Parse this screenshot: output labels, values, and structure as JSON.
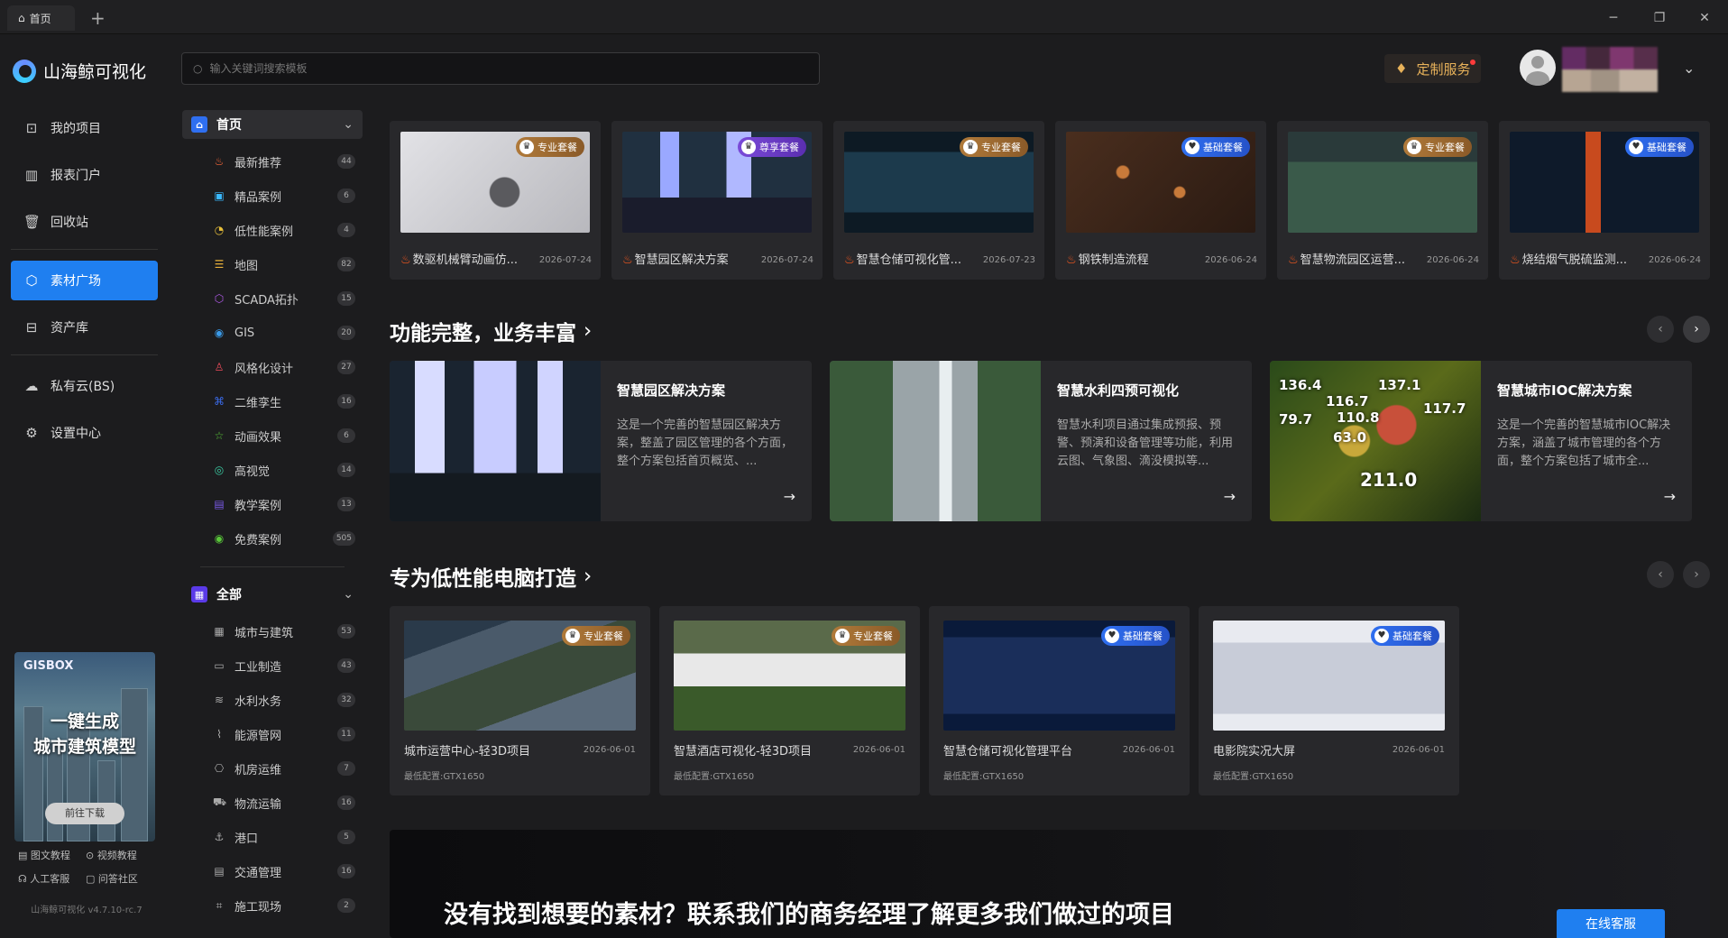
{
  "tabbar": {
    "tab_label": "首页",
    "add_tab": "+",
    "minimize": "─",
    "restore": "❐",
    "close": "✕"
  },
  "brand": {
    "name": "山海鲸可视化"
  },
  "search": {
    "placeholder": "输入关键词搜索模板"
  },
  "header": {
    "custom_service": "定制服务"
  },
  "nav": {
    "items": [
      {
        "label": "我的项目",
        "icon": "project-icon"
      },
      {
        "label": "报表门户",
        "icon": "report-icon"
      },
      {
        "label": "回收站",
        "icon": "trash-icon"
      },
      {
        "label": "素材广场",
        "icon": "cube-icon",
        "active": true
      },
      {
        "label": "资产库",
        "icon": "asset-icon"
      },
      {
        "label": "私有云(BS)",
        "icon": "cloud-icon"
      },
      {
        "label": "设置中心",
        "icon": "gear-icon"
      }
    ]
  },
  "promo": {
    "brand": "GISBOX",
    "line1": "一键生成",
    "line2": "城市建筑模型",
    "button": "前往下载"
  },
  "help": {
    "links": [
      "图文教程",
      "视频教程",
      "人工客服",
      "问答社区"
    ]
  },
  "version": "山海鲸可视化 v4.7.10-rc.7",
  "categories": {
    "home_label": "首页",
    "home_items": [
      {
        "label": "最新推荐",
        "count": "44",
        "color": "#ff6a3a",
        "glyph": "♨"
      },
      {
        "label": "精品案例",
        "count": "6",
        "color": "#3ab8ff",
        "glyph": "▣"
      },
      {
        "label": "低性能案例",
        "count": "4",
        "color": "#e8c03a",
        "glyph": "◔"
      },
      {
        "label": "地图",
        "count": "82",
        "color": "#e8b03a",
        "glyph": "☰"
      },
      {
        "label": "SCADA拓扑",
        "count": "15",
        "color": "#b05ae8",
        "glyph": "⬡"
      },
      {
        "label": "GIS",
        "count": "20",
        "color": "#3a9ae8",
        "glyph": "◉"
      },
      {
        "label": "风格化设计",
        "count": "27",
        "color": "#e84a5a",
        "glyph": "♙"
      },
      {
        "label": "二维孪生",
        "count": "16",
        "color": "#3a6ae8",
        "glyph": "⌘"
      },
      {
        "label": "动画效果",
        "count": "6",
        "color": "#5ac83a",
        "glyph": "☆"
      },
      {
        "label": "高视觉",
        "count": "14",
        "color": "#3ac8a0",
        "glyph": "◎"
      },
      {
        "label": "教学案例",
        "count": "13",
        "color": "#7a5ae8",
        "glyph": "▤"
      },
      {
        "label": "免费案例",
        "count": "505",
        "color": "#5ac83a",
        "glyph": "◉"
      }
    ],
    "all_label": "全部",
    "all_items": [
      {
        "label": "城市与建筑",
        "count": "53",
        "glyph": "▦"
      },
      {
        "label": "工业制造",
        "count": "43",
        "glyph": "▭"
      },
      {
        "label": "水利水务",
        "count": "32",
        "glyph": "≋"
      },
      {
        "label": "能源管网",
        "count": "11",
        "glyph": "⌇"
      },
      {
        "label": "机房运维",
        "count": "7",
        "glyph": "⎔"
      },
      {
        "label": "物流运输",
        "count": "16",
        "glyph": "⛟"
      },
      {
        "label": "港口",
        "count": "5",
        "glyph": "⚓"
      },
      {
        "label": "交通管理",
        "count": "16",
        "glyph": "▤"
      },
      {
        "label": "施工现场",
        "count": "2",
        "glyph": "⌗"
      }
    ]
  },
  "top_cards": [
    {
      "title": "数驱机械臂动画仿...",
      "date": "2026-07-24",
      "badge": "专业套餐",
      "tier": "pro",
      "hot": true
    },
    {
      "title": "智慧园区解决方案",
      "date": "2026-07-24",
      "badge": "尊享套餐",
      "tier": "prem",
      "hot": true
    },
    {
      "title": "智慧仓储可视化管...",
      "date": "2026-07-23",
      "badge": "专业套餐",
      "tier": "pro",
      "hot": true
    },
    {
      "title": "钢铁制造流程",
      "date": "2026-06-24",
      "badge": "基础套餐",
      "tier": "basic",
      "hot": true
    },
    {
      "title": "智慧物流园区运营...",
      "date": "2026-06-24",
      "badge": "专业套餐",
      "tier": "pro",
      "hot": true
    },
    {
      "title": "烧结烟气脱硫监测...",
      "date": "2026-06-24",
      "badge": "基础套餐",
      "tier": "basic",
      "hot": true
    }
  ],
  "section1": {
    "title": "功能完整，业务丰富"
  },
  "features": [
    {
      "title": "智慧园区解决方案",
      "desc": "这是一个完善的智慧园区解决方案，整盖了园区管理的各个方面，整个方案包括首页概览、..."
    },
    {
      "title": "智慧水利四预可视化",
      "desc": "智慧水利项目通过集成预报、预警、预演和设备管理等功能，利用云图、气象图、滴没模拟等..."
    },
    {
      "title": "智慧城市IOC解决方案",
      "desc": "这是一个完善的智慧城市IOC解决方案，涵盖了城市管理的各个方面，整个方案包括了城市全..."
    }
  ],
  "section2": {
    "title": "专为低性能电脑打造"
  },
  "low_cards": [
    {
      "title": "城市运营中心-轻3D项目",
      "date": "2026-06-01",
      "cfg": "最低配置:GTX1650",
      "badge": "专业套餐",
      "tier": "pro"
    },
    {
      "title": "智慧酒店可视化-轻3D项目",
      "date": "2026-06-01",
      "cfg": "最低配置:GTX1650",
      "badge": "专业套餐",
      "tier": "pro"
    },
    {
      "title": "智慧仓储可视化管理平台",
      "date": "2026-06-01",
      "cfg": "最低配置:GTX1650",
      "badge": "基础套餐",
      "tier": "basic"
    },
    {
      "title": "电影院实况大屏",
      "date": "2026-06-01",
      "cfg": "最低配置:GTX1650",
      "badge": "基础套餐",
      "tier": "basic"
    }
  ],
  "ioc_numbers": [
    "136.4",
    "137.1",
    "116.7",
    "79.7",
    "110.8",
    "117.7",
    "63.0",
    "211.0"
  ],
  "banner": {
    "text": "没有找到想要的素材？联系我们的商务经理了解更多我们做过的项目",
    "button": "在线客服"
  }
}
